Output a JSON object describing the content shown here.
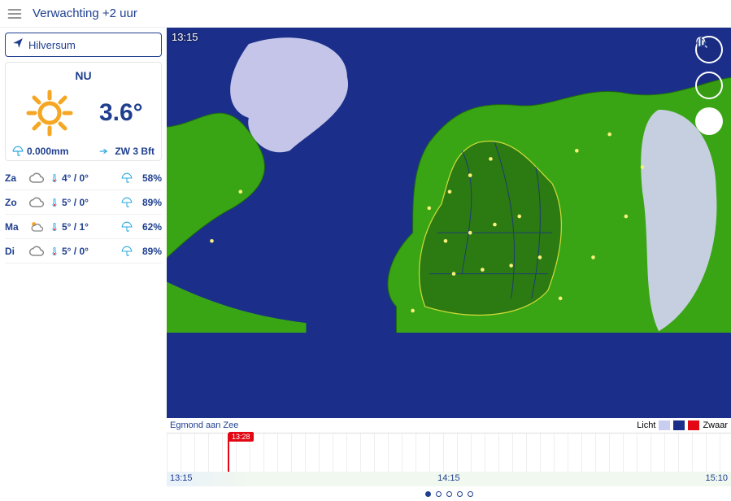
{
  "header": {
    "title": "Verwachting +2 uur"
  },
  "search": {
    "value": "Hilversum"
  },
  "now": {
    "label": "NU",
    "temperature": "3.6°",
    "precipitation": "0.000mm",
    "wind": "ZW 3 Bft"
  },
  "forecast": [
    {
      "day": "Za",
      "temps": "4° / 0°",
      "precipPct": "58%",
      "sunny": false
    },
    {
      "day": "Zo",
      "temps": "5° / 0°",
      "precipPct": "89%",
      "sunny": false
    },
    {
      "day": "Ma",
      "temps": "5° / 1°",
      "precipPct": "62%",
      "sunny": true
    },
    {
      "day": "Di",
      "temps": "5° / 0°",
      "precipPct": "89%",
      "sunny": false
    }
  ],
  "map": {
    "timestamp": "13:15",
    "cursorLocation": "Egmond aan Zee",
    "legend": {
      "lightLabel": "Licht",
      "heavyLabel": "Zwaar",
      "colors": [
        "#c9cdf0",
        "#1b2f8a",
        "#e30613"
      ]
    }
  },
  "timeline": {
    "markerTime": "13:28",
    "ticks": [
      "13:15",
      "14:15",
      "15:10"
    ]
  },
  "pager": {
    "count": 5,
    "selected": 0
  }
}
